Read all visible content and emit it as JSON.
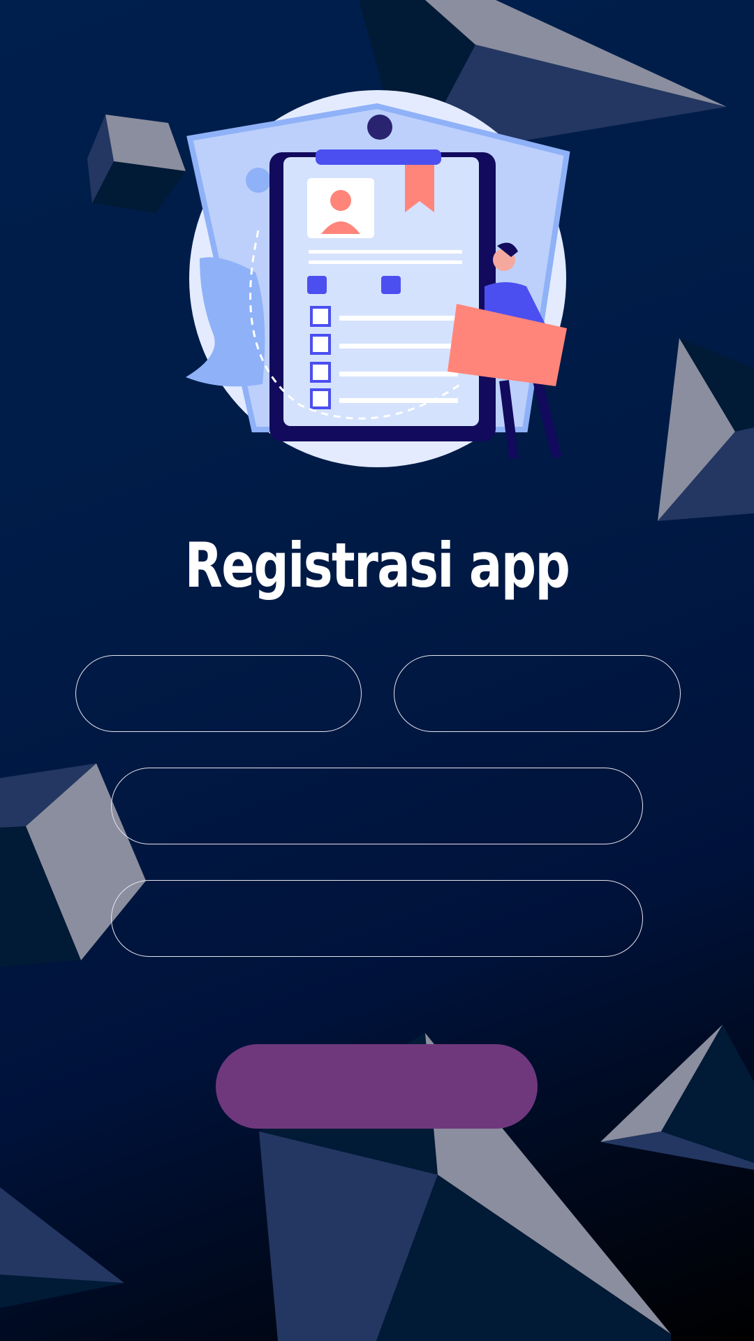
{
  "title": "Registrasi app",
  "form": {
    "field_1": {
      "value": "",
      "placeholder": ""
    },
    "field_2": {
      "value": "",
      "placeholder": ""
    },
    "field_3": {
      "value": "",
      "placeholder": ""
    },
    "field_4": {
      "value": "",
      "placeholder": ""
    },
    "submit_label": ""
  },
  "colors": {
    "background": "#001f4d",
    "button": "#6f387c",
    "field_border": "#e6e6ee",
    "text": "#ffffff"
  },
  "illustration": "clipboard-registration-illustration"
}
